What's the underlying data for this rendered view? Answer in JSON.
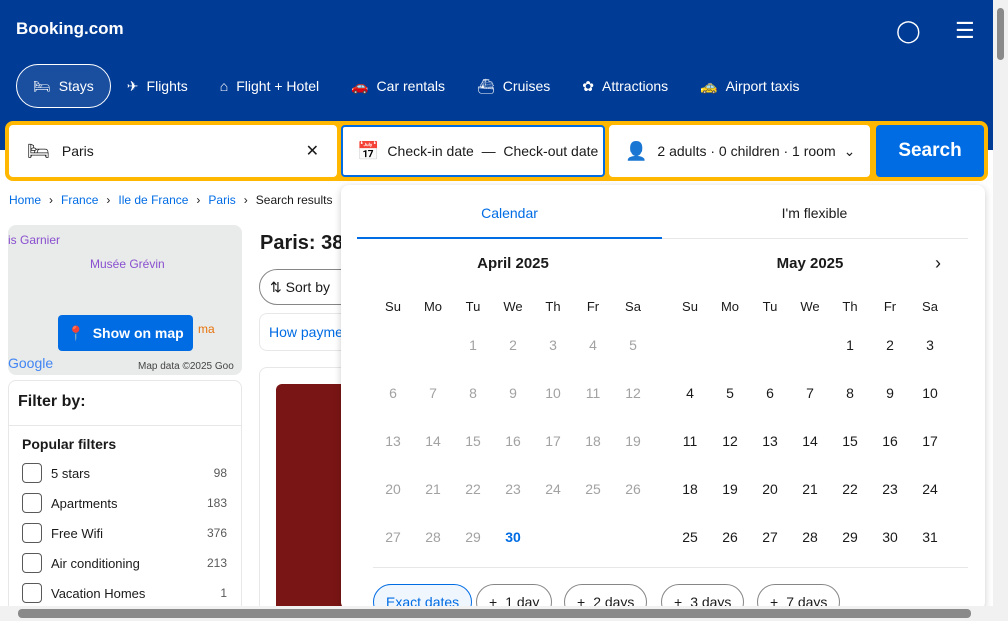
{
  "header": {
    "logo": "Booking.com",
    "nav": [
      {
        "label": "Stays",
        "icon": "bed-icon"
      },
      {
        "label": "Flights",
        "icon": "plane-icon"
      },
      {
        "label": "Flight + Hotel",
        "icon": "flight-hotel-icon"
      },
      {
        "label": "Car rentals",
        "icon": "car-icon"
      },
      {
        "label": "Cruises",
        "icon": "ship-icon"
      },
      {
        "label": "Attractions",
        "icon": "attractions-icon"
      },
      {
        "label": "Airport taxis",
        "icon": "taxi-icon"
      }
    ]
  },
  "search": {
    "destination": "Paris",
    "dates": "Check-in date  —  Check-out date",
    "guests": "2 adults · 0 children · 1 room",
    "button": "Search"
  },
  "breadcrumb": [
    "Home",
    "France",
    "Ile de France",
    "Paris",
    "Search results"
  ],
  "map": {
    "labels": [
      "is Garnier",
      "Musée Grévin",
      "ma"
    ],
    "button": "Show on map",
    "attribution": "Map data ©2025 Goo",
    "google": "Google"
  },
  "results": {
    "title": "Paris: 38",
    "sort": "Sort by",
    "payment": "How payme"
  },
  "filters": {
    "title": "Filter by:",
    "section": "Popular filters",
    "items": [
      {
        "label": "5 stars",
        "count": "98"
      },
      {
        "label": "Apartments",
        "count": "183"
      },
      {
        "label": "Free Wifi",
        "count": "376"
      },
      {
        "label": "Air conditioning",
        "count": "213"
      },
      {
        "label": "Vacation Homes",
        "count": "1"
      }
    ]
  },
  "calendar": {
    "tabs": [
      "Calendar",
      "I'm flexible"
    ],
    "weekdays": [
      "Su",
      "Mo",
      "Tu",
      "We",
      "Th",
      "Fr",
      "Sa"
    ],
    "months": [
      {
        "title": "April 2025",
        "start": 2,
        "days": 30,
        "today": 30
      },
      {
        "title": "May 2025",
        "start": 4,
        "days": 31
      }
    ],
    "flex": [
      "Exact dates",
      "1 day",
      "2 days",
      "3 days",
      "7 days"
    ]
  }
}
